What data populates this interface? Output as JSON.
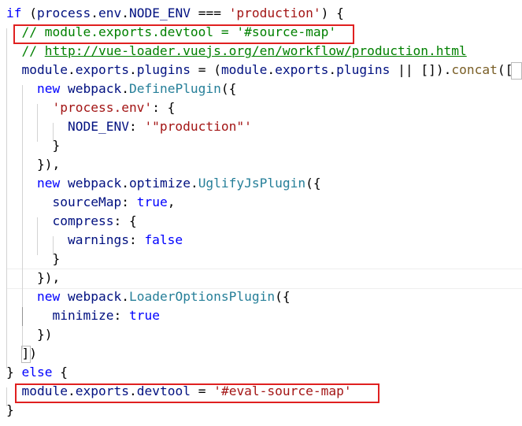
{
  "editor": {
    "language": "javascript",
    "colors": {
      "keyword": "#0000ff",
      "variable": "#001080",
      "function": "#795e26",
      "type": "#267f99",
      "string": "#a31515",
      "comment": "#008000",
      "annotation_box": "#e02020"
    },
    "lines": [
      [
        {
          "t": "if",
          "c": "kw"
        },
        {
          "t": " (",
          "c": "punc"
        },
        {
          "t": "process",
          "c": "var"
        },
        {
          "t": ".",
          "c": "punc"
        },
        {
          "t": "env",
          "c": "var"
        },
        {
          "t": ".",
          "c": "punc"
        },
        {
          "t": "NODE_ENV",
          "c": "var"
        },
        {
          "t": " === ",
          "c": "punc"
        },
        {
          "t": "'production'",
          "c": "str"
        },
        {
          "t": ") {",
          "c": "punc"
        }
      ],
      [
        {
          "t": "  ",
          "c": "punc"
        },
        {
          "t": "// module.exports.devtool = '#source-map'",
          "c": "com"
        }
      ],
      [
        {
          "t": "  ",
          "c": "punc"
        },
        {
          "t": "// ",
          "c": "com"
        },
        {
          "t": "http://vue-loader.vuejs.org/en/workflow/production.html",
          "c": "url"
        }
      ],
      [
        {
          "t": "  ",
          "c": "punc"
        },
        {
          "t": "module",
          "c": "var"
        },
        {
          "t": ".",
          "c": "punc"
        },
        {
          "t": "exports",
          "c": "var"
        },
        {
          "t": ".",
          "c": "punc"
        },
        {
          "t": "plugins",
          "c": "var"
        },
        {
          "t": " = (",
          "c": "punc"
        },
        {
          "t": "module",
          "c": "var"
        },
        {
          "t": ".",
          "c": "punc"
        },
        {
          "t": "exports",
          "c": "var"
        },
        {
          "t": ".",
          "c": "punc"
        },
        {
          "t": "plugins",
          "c": "var"
        },
        {
          "t": " || []).",
          "c": "punc"
        },
        {
          "t": "concat",
          "c": "fn"
        },
        {
          "t": "([",
          "c": "punc"
        }
      ],
      [
        {
          "t": "    ",
          "c": "punc"
        },
        {
          "t": "new",
          "c": "kw"
        },
        {
          "t": " ",
          "c": "punc"
        },
        {
          "t": "webpack",
          "c": "var"
        },
        {
          "t": ".",
          "c": "punc"
        },
        {
          "t": "DefinePlugin",
          "c": "type"
        },
        {
          "t": "({",
          "c": "punc"
        }
      ],
      [
        {
          "t": "      ",
          "c": "punc"
        },
        {
          "t": "'process.env'",
          "c": "str"
        },
        {
          "t": ": {",
          "c": "punc"
        }
      ],
      [
        {
          "t": "        ",
          "c": "punc"
        },
        {
          "t": "NODE_ENV",
          "c": "var"
        },
        {
          "t": ": ",
          "c": "punc"
        },
        {
          "t": "'\"production\"'",
          "c": "str"
        }
      ],
      [
        {
          "t": "      }",
          "c": "punc"
        }
      ],
      [
        {
          "t": "    }),",
          "c": "punc"
        }
      ],
      [
        {
          "t": "    ",
          "c": "punc"
        },
        {
          "t": "new",
          "c": "kw"
        },
        {
          "t": " ",
          "c": "punc"
        },
        {
          "t": "webpack",
          "c": "var"
        },
        {
          "t": ".",
          "c": "punc"
        },
        {
          "t": "optimize",
          "c": "var"
        },
        {
          "t": ".",
          "c": "punc"
        },
        {
          "t": "UglifyJsPlugin",
          "c": "type"
        },
        {
          "t": "({",
          "c": "punc"
        }
      ],
      [
        {
          "t": "      ",
          "c": "punc"
        },
        {
          "t": "sourceMap",
          "c": "var"
        },
        {
          "t": ": ",
          "c": "punc"
        },
        {
          "t": "true",
          "c": "kw"
        },
        {
          "t": ",",
          "c": "punc"
        }
      ],
      [
        {
          "t": "      ",
          "c": "punc"
        },
        {
          "t": "compress",
          "c": "var"
        },
        {
          "t": ": {",
          "c": "punc"
        }
      ],
      [
        {
          "t": "        ",
          "c": "punc"
        },
        {
          "t": "warnings",
          "c": "var"
        },
        {
          "t": ": ",
          "c": "punc"
        },
        {
          "t": "false",
          "c": "kw"
        }
      ],
      [
        {
          "t": "      }",
          "c": "punc"
        }
      ],
      [
        {
          "t": "    }),",
          "c": "punc"
        }
      ],
      [
        {
          "t": "    ",
          "c": "punc"
        },
        {
          "t": "new",
          "c": "kw"
        },
        {
          "t": " ",
          "c": "punc"
        },
        {
          "t": "webpack",
          "c": "var"
        },
        {
          "t": ".",
          "c": "punc"
        },
        {
          "t": "LoaderOptionsPlugin",
          "c": "type"
        },
        {
          "t": "({",
          "c": "punc"
        }
      ],
      [
        {
          "t": "      ",
          "c": "punc"
        },
        {
          "t": "minimize",
          "c": "var"
        },
        {
          "t": ": ",
          "c": "punc"
        },
        {
          "t": "true",
          "c": "kw"
        }
      ],
      [
        {
          "t": "    })",
          "c": "punc"
        }
      ],
      [
        {
          "t": "  ])",
          "c": "punc"
        }
      ],
      [
        {
          "t": "} ",
          "c": "punc"
        },
        {
          "t": "else",
          "c": "kw"
        },
        {
          "t": " {",
          "c": "punc"
        }
      ],
      [
        {
          "t": "  ",
          "c": "punc"
        },
        {
          "t": "module",
          "c": "var"
        },
        {
          "t": ".",
          "c": "punc"
        },
        {
          "t": "exports",
          "c": "var"
        },
        {
          "t": ".",
          "c": "punc"
        },
        {
          "t": "devtool",
          "c": "var"
        },
        {
          "t": " = ",
          "c": "punc"
        },
        {
          "t": "'#eval-source-map'",
          "c": "str"
        }
      ],
      [
        {
          "t": "}",
          "c": "punc"
        }
      ]
    ]
  }
}
